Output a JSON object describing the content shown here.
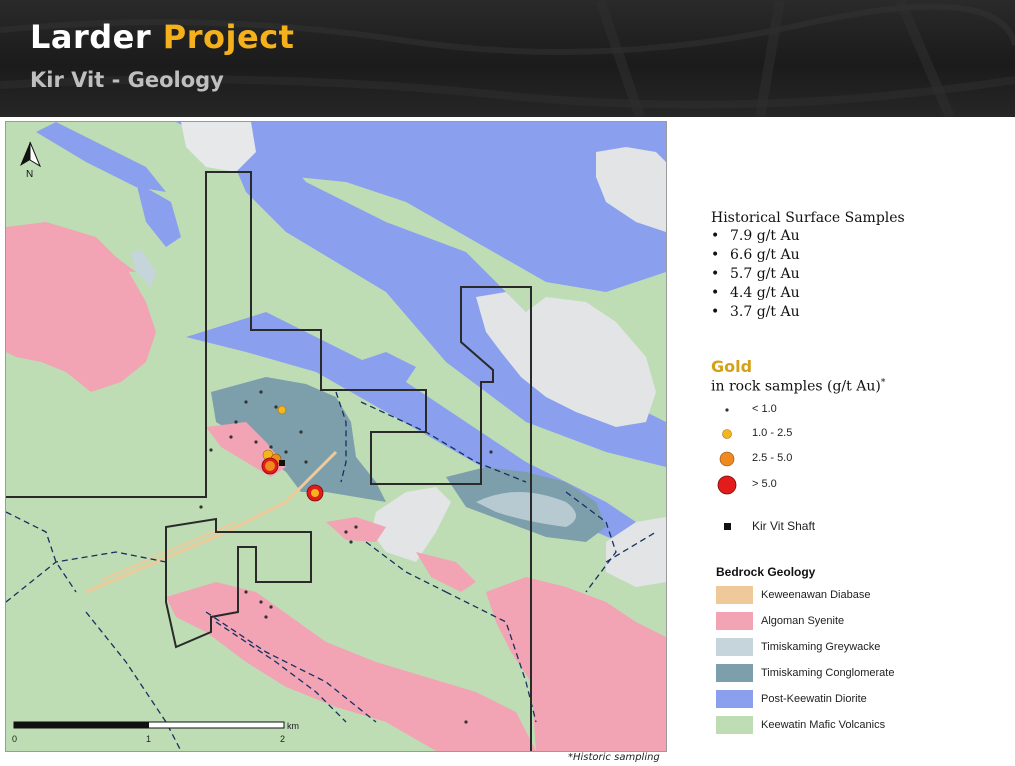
{
  "header": {
    "title_part1": "Larder",
    "title_part2": "Project",
    "subtitle": "Kir Vit - Geology",
    "accent_color": "#f5b11c"
  },
  "map": {
    "north_label": "N",
    "scale": {
      "unit": "km",
      "ticks": [
        "0",
        "1",
        "2"
      ]
    },
    "footnote": "*Historic sampling"
  },
  "historical_samples": {
    "heading": "Historical Surface Samples",
    "bullet": "•",
    "items": [
      "7.9 g/t Au",
      "6.6 g/t Au",
      "5.7 g/t Au",
      "4.4 g/t Au",
      "3.7 g/t Au"
    ]
  },
  "gold_legend": {
    "title": "Gold",
    "subtitle": "in rock samples (g/t Au)",
    "subtitle_mark": "*",
    "classes": [
      {
        "label": "< 1.0",
        "color": "#333333"
      },
      {
        "label": "1.0 - 2.5",
        "color": "#f5b51c"
      },
      {
        "label": "2.5 - 5.0",
        "color": "#f08a1e"
      },
      {
        "label": "> 5.0",
        "color": "#e21b1b"
      }
    ],
    "shaft_label": "Kir Vit Shaft"
  },
  "bedrock_geology": {
    "title": "Bedrock Geology",
    "units": [
      {
        "label": "Keweenawan Diabase",
        "color": "#efc99a"
      },
      {
        "label": "Algoman Syenite",
        "color": "#f2a3b4"
      },
      {
        "label": "Timiskaming Greywacke",
        "color": "#c6d4dc"
      },
      {
        "label": "Timiskaming Conglomerate",
        "color": "#7c9fab"
      },
      {
        "label": "Post-Keewatin Diorite",
        "color": "#8aa0ef"
      },
      {
        "label": "Keewatin Mafic Volcanics",
        "color": "#bfddb5"
      }
    ]
  }
}
